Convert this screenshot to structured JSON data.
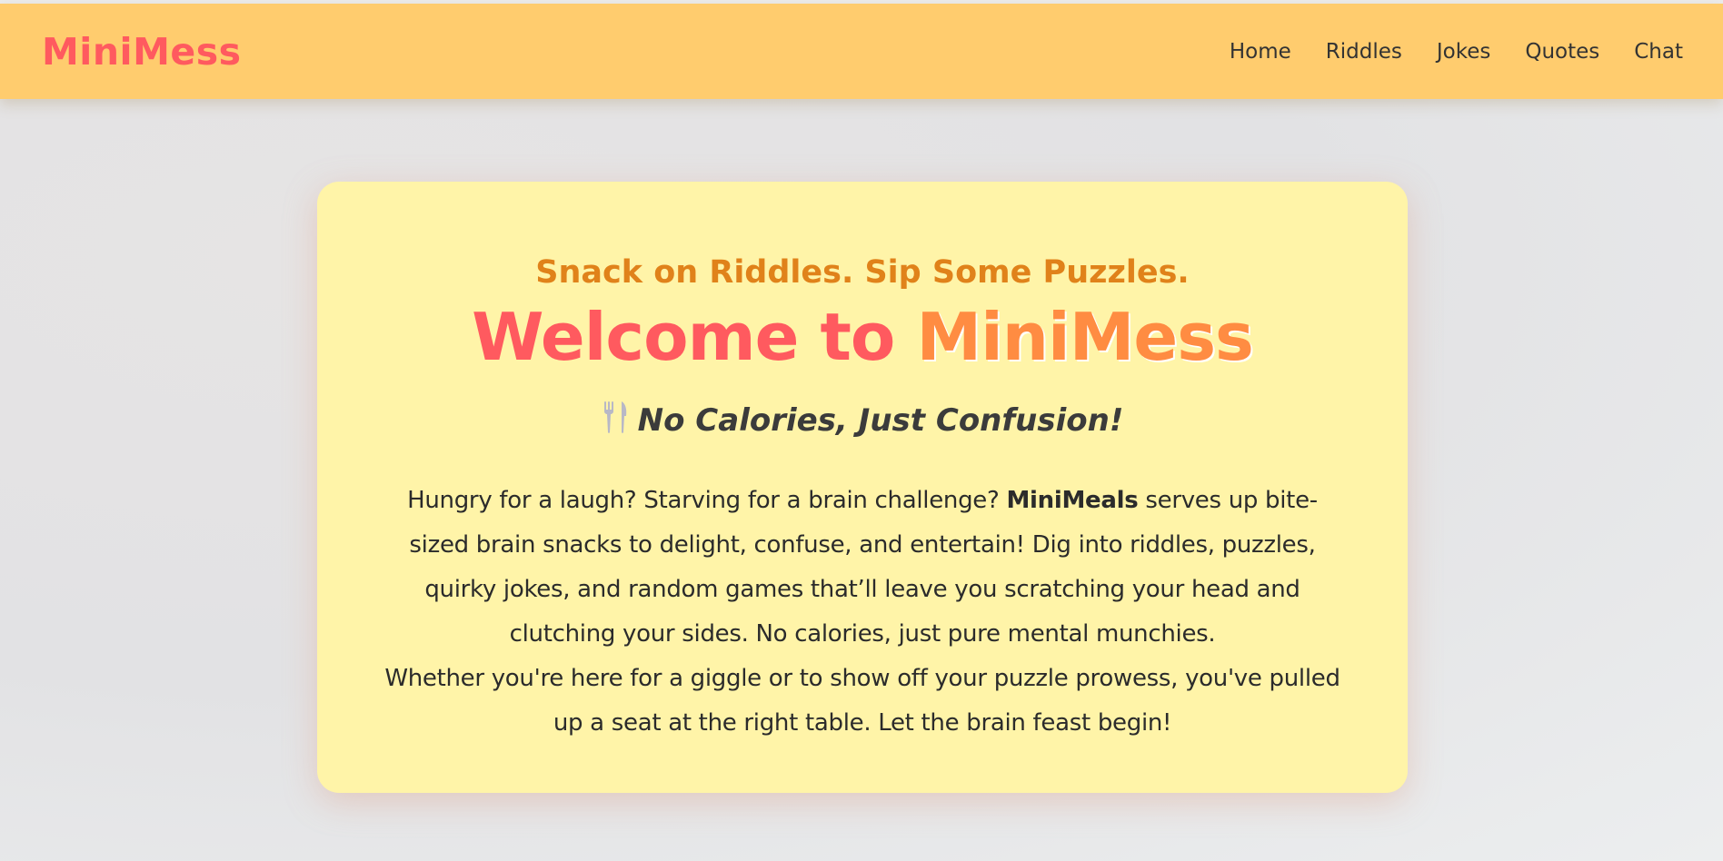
{
  "nav": {
    "brand": "MiniMess",
    "links": [
      "Home",
      "Riddles",
      "Jokes",
      "Quotes",
      "Chat"
    ]
  },
  "hero": {
    "tagline": "Snack on Riddles. Sip Some Puzzles.",
    "headline_part1": "Welcome to",
    "headline_part2": "MiniMess",
    "subheadline": "No Calories, Just Confusion!",
    "subheadline_icon": "fork-and-knife-icon",
    "paragraph1_before": "Hungry for a laugh? Starving for a brain challenge?",
    "paragraph1_bold": "MiniMeals",
    "paragraph1_after": "serves up bite-sized brain snacks to delight, confuse, and entertain! Dig into riddles, puzzles, quirky jokes, and random games that’ll leave you scratching your head and clutching your sides. No calories, just pure mental munchies.",
    "paragraph2": "Whether you're here for a giggle or to show off your puzzle prowess, you've pulled up a seat at the right table. Let the brain feast begin!"
  },
  "colors": {
    "navbar_bg": "#ffcc6e",
    "brand": "#ff5a5f",
    "card_bg": "#fff4a8",
    "tagline": "#e0821a",
    "headline_accent": "#ff8c42"
  }
}
